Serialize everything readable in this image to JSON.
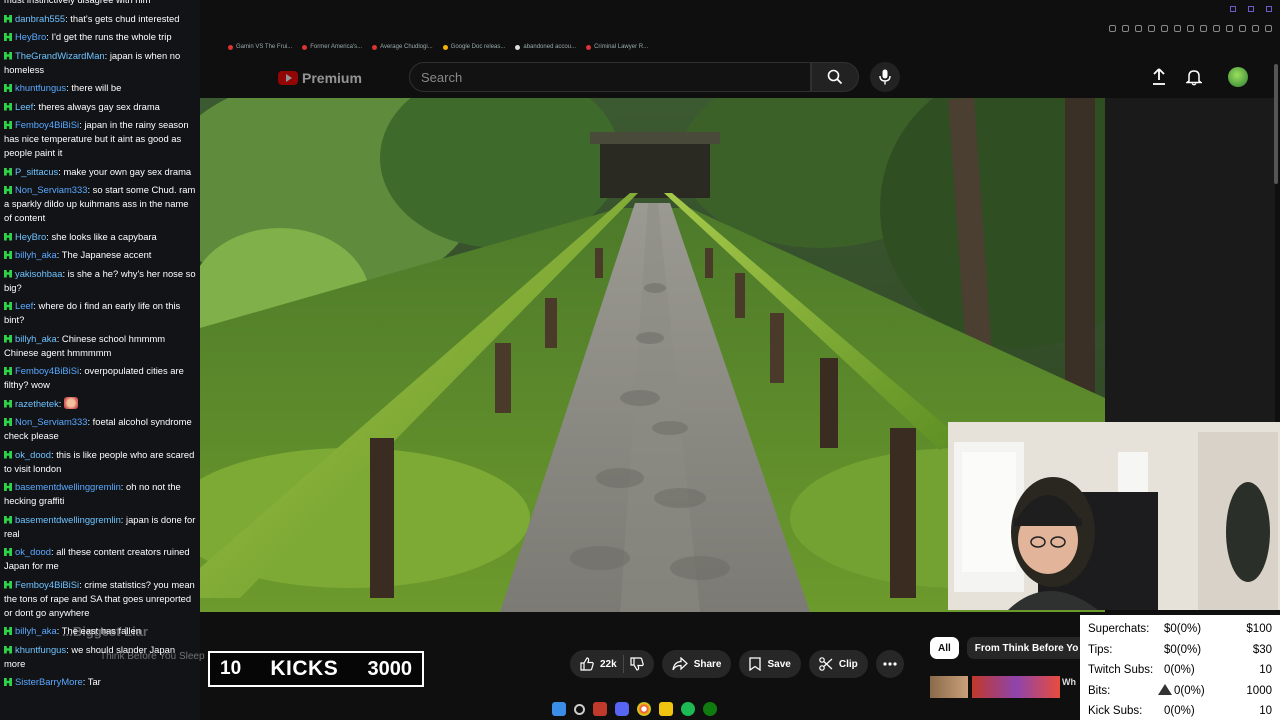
{
  "browser": {
    "bookmarks": [
      "Gamin VS The Frui...",
      "Former America's...",
      "Average Chudlogi...",
      "Google Doc releas...",
      "abandoned accou...",
      "Criminal Lawyer R..."
    ]
  },
  "header": {
    "logo_text": "Premium",
    "search_placeholder": "Search"
  },
  "chat": {
    "messages": [
      {
        "user": "",
        "text": "must instinctively disagree with him"
      },
      {
        "user": "danbrah555",
        "text": "that's gets chud interested"
      },
      {
        "user": "HeyBro",
        "text": "I'd get the runs the whole trip"
      },
      {
        "user": "TheGrandWizardMan",
        "text": "japan is when no homeless"
      },
      {
        "user": "khuntfungus",
        "text": "there will be"
      },
      {
        "user": "Leef",
        "text": "theres always gay sex drama"
      },
      {
        "user": "Femboy4BiBiSi",
        "text": "japan in the rainy season has nice temperature but it aint as good as people paint it"
      },
      {
        "user": "P_sittacus",
        "text": "make your own gay sex drama"
      },
      {
        "user": "Non_Serviam333",
        "text": "so start some Chud. ram a sparkly dildo up kuihmans ass in the name of content"
      },
      {
        "user": "HeyBro",
        "text": "she looks like a capybara"
      },
      {
        "user": "billyh_aka",
        "text": "The Japanese accent"
      },
      {
        "user": "yakisohbaa",
        "text": "is she a he? why's her nose so big?"
      },
      {
        "user": "Leef",
        "text": "where do i find an early life on this bint?"
      },
      {
        "user": "billyh_aka",
        "text": "Chinese school hmmmm Chinese agent hmmmmm"
      },
      {
        "user": "Femboy4BiBiSi",
        "text": "overpopulated cities are filthy? wow"
      },
      {
        "user": "razethetek",
        "text": ""
      },
      {
        "user": "Non_Serviam333",
        "text": "foetal alcohol syndrome check please"
      },
      {
        "user": "ok_dood",
        "text": "this is like people who are scared to visit london"
      },
      {
        "user": "basementdwellinggremlin",
        "text": "oh no not the hecking graffiti"
      },
      {
        "user": "basementdwellinggremlin",
        "text": "japan is done for real"
      },
      {
        "user": "ok_dood",
        "text": "all these content creators ruined Japan for me"
      },
      {
        "user": "Femboy4BiBiSi",
        "text": "crime statistics? you mean the tons of rape and SA that goes unreported or dont go anywhere"
      },
      {
        "user": "billyh_aka",
        "text": "The east has fallen"
      },
      {
        "user": "khuntfungus",
        "text": "we should slander Japan more"
      },
      {
        "user": "SisterBarryMore",
        "text": "Tar"
      }
    ]
  },
  "overlay": {
    "ghost_title": "...Biggest Liar",
    "ghost_channel": "Think Before You Sleep",
    "kicks_count": "10",
    "kicks_label": "KICKS",
    "kicks_goal": "3000"
  },
  "actions": {
    "likes": "22k",
    "share": "Share",
    "save": "Save",
    "clip": "Clip"
  },
  "chips": {
    "all": "All",
    "from": "From Think Before Yo"
  },
  "related": {
    "title_fragment": "Wh"
  },
  "stats": {
    "rows": [
      {
        "label": "Superchats:",
        "value": "$0(0%)",
        "goal": "$100"
      },
      {
        "label": "Tips:",
        "value": "$0(0%)",
        "goal": "$30"
      },
      {
        "label": "Twitch Subs:",
        "value": "0(0%)",
        "goal": "10"
      },
      {
        "label": "Bits:",
        "value": "0(0%)",
        "goal": "1000"
      },
      {
        "label": "Kick Subs:",
        "value": "0(0%)",
        "goal": "10"
      }
    ]
  }
}
